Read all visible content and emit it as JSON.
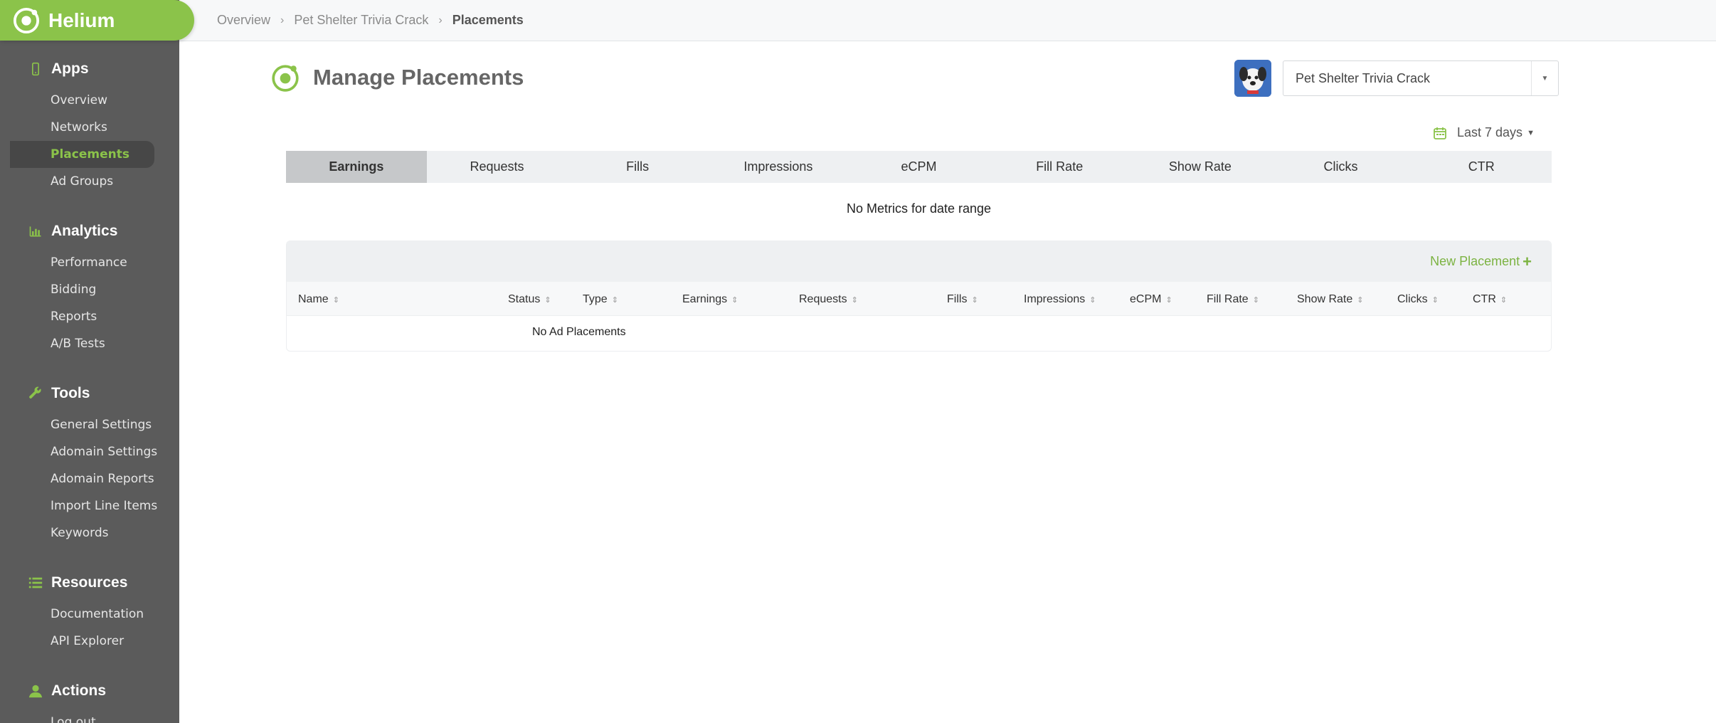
{
  "app": {
    "name": "Helium"
  },
  "breadcrumb": [
    "Overview",
    "Pet Shelter Trivia Crack",
    "Placements"
  ],
  "sidebar": {
    "sections": [
      {
        "title": "Apps",
        "icon": "phone-icon",
        "items": [
          {
            "label": "Overview",
            "active": false
          },
          {
            "label": "Networks",
            "active": false
          },
          {
            "label": "Placements",
            "active": true
          },
          {
            "label": "Ad Groups",
            "active": false
          }
        ]
      },
      {
        "title": "Analytics",
        "icon": "bar-chart-icon",
        "items": [
          {
            "label": "Performance",
            "active": false
          },
          {
            "label": "Bidding",
            "active": false
          },
          {
            "label": "Reports",
            "active": false
          },
          {
            "label": "A/B Tests",
            "active": false
          }
        ]
      },
      {
        "title": "Tools",
        "icon": "wrench-icon",
        "items": [
          {
            "label": "General Settings",
            "active": false
          },
          {
            "label": "Adomain Settings",
            "active": false
          },
          {
            "label": "Adomain Reports",
            "active": false
          },
          {
            "label": "Import Line Items",
            "active": false
          },
          {
            "label": "Keywords",
            "active": false
          }
        ]
      },
      {
        "title": "Resources",
        "icon": "list-icon",
        "items": [
          {
            "label": "Documentation",
            "active": false
          },
          {
            "label": "API Explorer",
            "active": false
          }
        ]
      },
      {
        "title": "Actions",
        "icon": "user-icon",
        "items": [
          {
            "label": "Log out",
            "active": false
          }
        ]
      }
    ]
  },
  "page": {
    "title": "Manage Placements",
    "app_selector": {
      "selected": "Pet Shelter Trivia Crack"
    },
    "date_range": "Last 7 days",
    "metric_tabs": [
      "Earnings",
      "Requests",
      "Fills",
      "Impressions",
      "eCPM",
      "Fill Rate",
      "Show Rate",
      "Clicks",
      "CTR"
    ],
    "active_metric": "Earnings",
    "no_metrics_text": "No Metrics for date range",
    "new_placement_label": "New Placement",
    "table": {
      "columns": [
        "Name",
        "Status",
        "Type",
        "Earnings",
        "Requests",
        "Fills",
        "Impressions",
        "eCPM",
        "Fill Rate",
        "Show Rate",
        "Clicks",
        "CTR"
      ],
      "empty_text": "No Ad Placements"
    }
  },
  "colors": {
    "accent": "#8bc34a",
    "sidebar": "#5b5b5b"
  }
}
